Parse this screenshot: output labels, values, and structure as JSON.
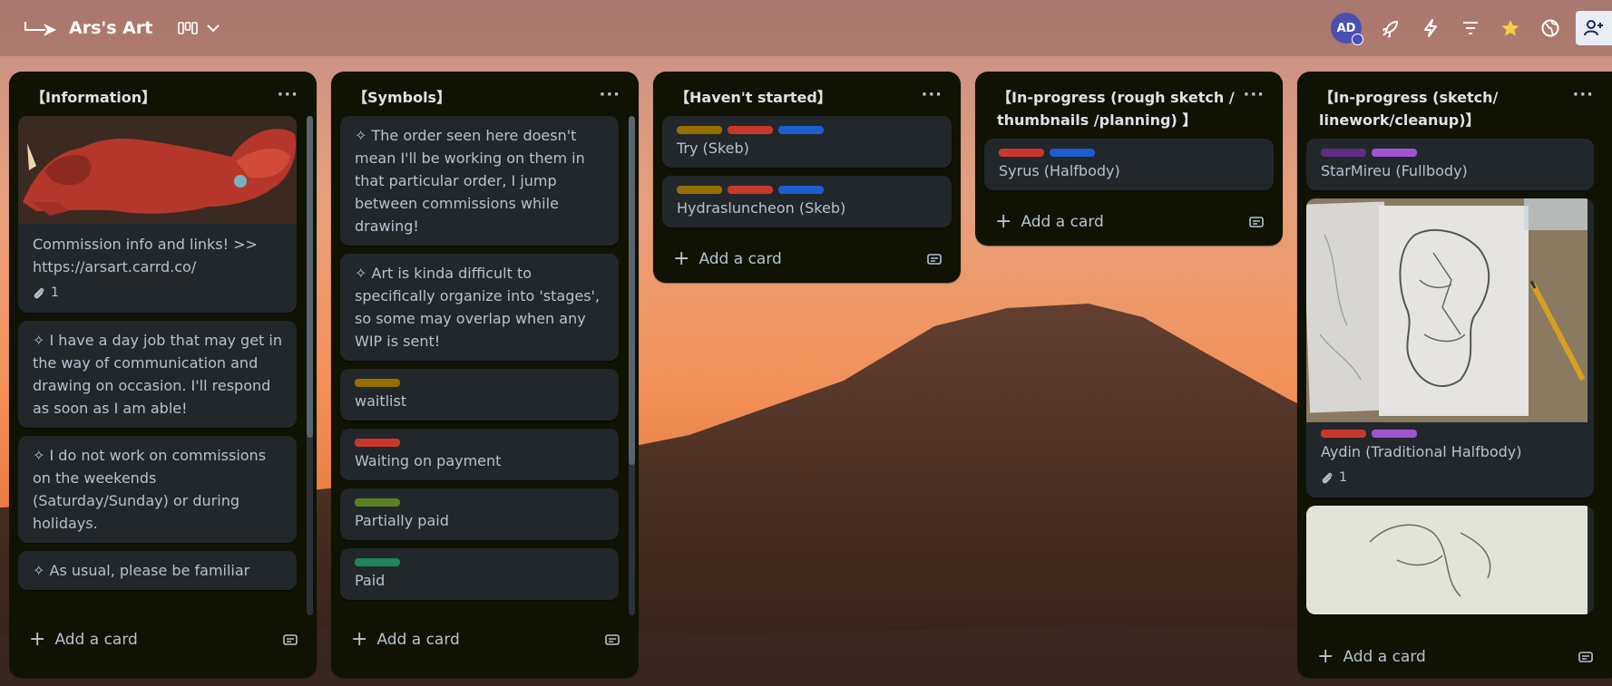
{
  "header": {
    "board_title": "Ars's Art",
    "avatar_initials": "AD",
    "icons": [
      "power-ups-icon",
      "automation-icon",
      "filter-icon",
      "star-icon",
      "globe-icon",
      "share-icon"
    ]
  },
  "colors": {
    "list_bg": "#101204",
    "card_bg": "#22272b",
    "label_yellow": "#946f00",
    "label_red": "#c9372c",
    "label_blue": "#1d5dd0",
    "label_purple_dark": "#5c2d82",
    "label_purple": "#9f55d3",
    "label_green_lime": "#5b7f24",
    "label_green": "#1f845a"
  },
  "lists": [
    {
      "title": "【Information】",
      "add_card_label": "Add a card",
      "cards": [
        {
          "text": "Commission info and links! >> https://arsart.carrd.co/",
          "attachments": "1"
        },
        {
          "text": "✧ I have a day job that may get in the way of communication and drawing on occasion. I'll respond as soon as I am able!"
        },
        {
          "text": "✧ I do not work on commissions on the weekends (Saturday/Sunday) or during holidays."
        },
        {
          "text": "✧ As usual, please be familiar"
        }
      ]
    },
    {
      "title": "【Symbols】",
      "add_card_label": "Add a card",
      "cards": [
        {
          "text": "✧ The order seen here doesn't mean I'll be working on them in that particular order, I jump between commissions while drawing!"
        },
        {
          "text": "✧ Art is kinda difficult to specifically organize into 'stages', so some may overlap when any WIP is sent!"
        },
        {
          "text": "waitlist"
        },
        {
          "text": "Waiting on payment"
        },
        {
          "text": "Partially paid"
        },
        {
          "text": "Paid"
        }
      ]
    },
    {
      "title": "【Haven't started】",
      "add_card_label": "Add a card",
      "cards": [
        {
          "text": "Try (Skeb)"
        },
        {
          "text": "Hydrasluncheon (Skeb)"
        }
      ]
    },
    {
      "title": "【In-progress (rough sketch / thumbnails /planning) 】",
      "add_card_label": "Add a card",
      "cards": [
        {
          "text": "Syrus (Halfbody)"
        }
      ]
    },
    {
      "title": "【In-progress (sketch/ linework/cleanup)】",
      "add_card_label": "Add a card",
      "cards": [
        {
          "text": "StarMireu (Fullbody)"
        },
        {
          "text": "Aydin (Traditional Halfbody)",
          "attachments": "1"
        }
      ]
    }
  ]
}
